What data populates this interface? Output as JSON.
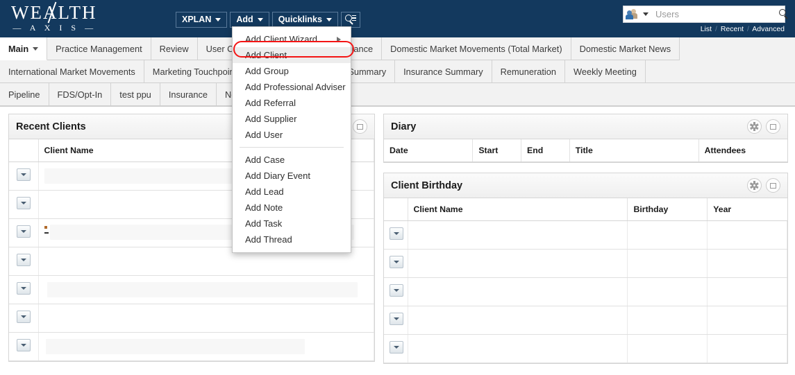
{
  "brand": {
    "name_main": "WEALTH",
    "name_sub": "— A X I S —",
    "navy": "#13395e"
  },
  "topbar": {
    "buttons": [
      {
        "label": "XPLAN",
        "icon": "chevron-down-icon"
      },
      {
        "label": "Add",
        "icon": "chevron-down-icon"
      },
      {
        "label": "Quicklinks",
        "icon": "chevron-down-icon"
      }
    ],
    "search_button_icon": "search-list-icon",
    "user_search": {
      "icon": "people-icon",
      "placeholder": "Users",
      "value": "",
      "magnifier_icon": "search-icon",
      "links": [
        "List",
        "Recent",
        "Advanced"
      ]
    }
  },
  "add_menu": {
    "highlight_color": "#f41414",
    "items": [
      {
        "label": "Add Client Wizard",
        "has_submenu": true,
        "highlighted": false
      },
      {
        "label": "Add Client",
        "has_submenu": false,
        "highlighted": true
      },
      {
        "label": "Add Group",
        "has_submenu": false,
        "highlighted": false
      },
      {
        "label": "Add Professional Adviser",
        "has_submenu": false,
        "highlighted": false
      },
      {
        "label": "Add Referral",
        "has_submenu": false,
        "highlighted": false
      },
      {
        "label": "Add Supplier",
        "has_submenu": false,
        "highlighted": false
      },
      {
        "label": "Add User",
        "has_submenu": false,
        "highlighted": false
      },
      {
        "label": "__divider__",
        "has_submenu": false,
        "highlighted": false
      },
      {
        "label": "Add Case",
        "has_submenu": false,
        "highlighted": false
      },
      {
        "label": "Add Diary Event",
        "has_submenu": false,
        "highlighted": false
      },
      {
        "label": "Add Lead",
        "has_submenu": false,
        "highlighted": false
      },
      {
        "label": "Add Note",
        "has_submenu": false,
        "highlighted": false
      },
      {
        "label": "Add Task",
        "has_submenu": false,
        "highlighted": false
      },
      {
        "label": "Add Thread",
        "has_submenu": false,
        "highlighted": false
      }
    ]
  },
  "tabs": {
    "row1": [
      {
        "label": "Main",
        "active": true,
        "caret": true
      },
      {
        "label": "Practice Management",
        "active": false,
        "caret": false
      },
      {
        "label": "Review",
        "active": false,
        "caret": false
      },
      {
        "label": "User Compliance",
        "active": false,
        "caret": false
      },
      {
        "label": "Practice Compliance",
        "active": false,
        "caret": false
      },
      {
        "label": "Domestic Market Movements (Total Market)",
        "active": false,
        "caret": false
      },
      {
        "label": "Domestic Market News",
        "active": false,
        "caret": false
      }
    ],
    "row2": [
      {
        "label": "International Market Movements"
      },
      {
        "label": "Marketing Touchpoints"
      },
      {
        "label": "Portfolio Management Summary"
      },
      {
        "label": "Insurance Summary"
      },
      {
        "label": "Remuneration"
      },
      {
        "label": "Weekly Meeting"
      }
    ],
    "row3": [
      {
        "label": "Pipeline"
      },
      {
        "label": "FDS/Opt-In"
      },
      {
        "label": "test ppu"
      },
      {
        "label": "Insurance"
      },
      {
        "label": "New"
      }
    ]
  },
  "panels": {
    "recent_clients": {
      "title": "Recent Clients",
      "actions": [
        "restore-icon"
      ],
      "columns": [
        "Client Name"
      ],
      "rows": [
        {
          "client_name": ""
        },
        {
          "client_name": ""
        },
        {
          "client_name": ""
        },
        {
          "client_name": ""
        },
        {
          "client_name": ""
        },
        {
          "client_name": ""
        },
        {
          "client_name": ""
        }
      ]
    },
    "diary": {
      "title": "Diary",
      "actions": [
        "gear-icon",
        "restore-icon"
      ],
      "columns": [
        "Date",
        "Start",
        "End",
        "Title",
        "Attendees"
      ],
      "rows": []
    },
    "client_birthday": {
      "title": "Client Birthday",
      "actions": [
        "gear-icon",
        "restore-icon"
      ],
      "columns": [
        "Client Name",
        "Birthday",
        "Year"
      ],
      "rows": [
        {
          "client_name": "",
          "birthday": "",
          "year": ""
        },
        {
          "client_name": "",
          "birthday": "",
          "year": ""
        },
        {
          "client_name": "",
          "birthday": "",
          "year": ""
        },
        {
          "client_name": "",
          "birthday": "",
          "year": ""
        },
        {
          "client_name": "",
          "birthday": "",
          "year": ""
        }
      ]
    }
  }
}
